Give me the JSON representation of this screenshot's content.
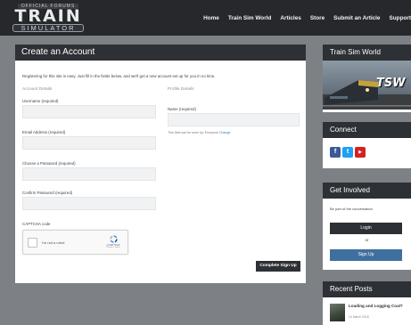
{
  "header": {
    "logo_small": "OFFICIAL FORUMS",
    "logo_big": "TRAIN",
    "logo_sub": "SIMULATOR",
    "nav": [
      "Home",
      "Train Sim World",
      "Articles",
      "Store",
      "Submit an Article",
      "Support"
    ]
  },
  "form": {
    "title": "Create an Account",
    "intro": "Registering for this site is easy. Just fill in the fields below, and we'll get a new account set up for you in no time.",
    "account_details_title": "Account Details",
    "profile_details_title": "Profile Details",
    "username_label": "Username (required)",
    "email_label": "Email Address (required)",
    "password_label": "Choose a Password (required)",
    "confirm_password_label": "Confirm Password (required)",
    "name_label": "Name (required)",
    "name_hint": "This field can be seen by: Everyone",
    "name_hint_link": "Change",
    "captcha_label": "CAPTCHA code",
    "captcha_text": "I'm not a robot",
    "captcha_brand": "reCAPTCHA",
    "captcha_terms": "Privacy - Terms",
    "submit_label": "Complete Sign Up"
  },
  "sidebar": {
    "tsw": {
      "title": "Train Sim World",
      "image_text": "TSW"
    },
    "connect": {
      "title": "Connect",
      "icons": [
        {
          "name": "facebook-icon",
          "glyph": "f",
          "color": "#3b5998"
        },
        {
          "name": "twitter-icon",
          "glyph": "t",
          "color": "#1da1f2"
        },
        {
          "name": "youtube-icon",
          "glyph": "▶",
          "color": "#d32323"
        }
      ]
    },
    "involved": {
      "title": "Get Involved",
      "text": "Be part of the conversation",
      "login_label": "Login",
      "or_label": "or",
      "signup_label": "Sign Up"
    },
    "recent": {
      "title": "Recent Posts",
      "post_title": "Loading and Logging Coal?",
      "post_date": "14 March 2018"
    }
  },
  "colors": {
    "background": "#7d8186",
    "header_dark": "#2d3034",
    "signup_blue": "#3f6f9f"
  }
}
